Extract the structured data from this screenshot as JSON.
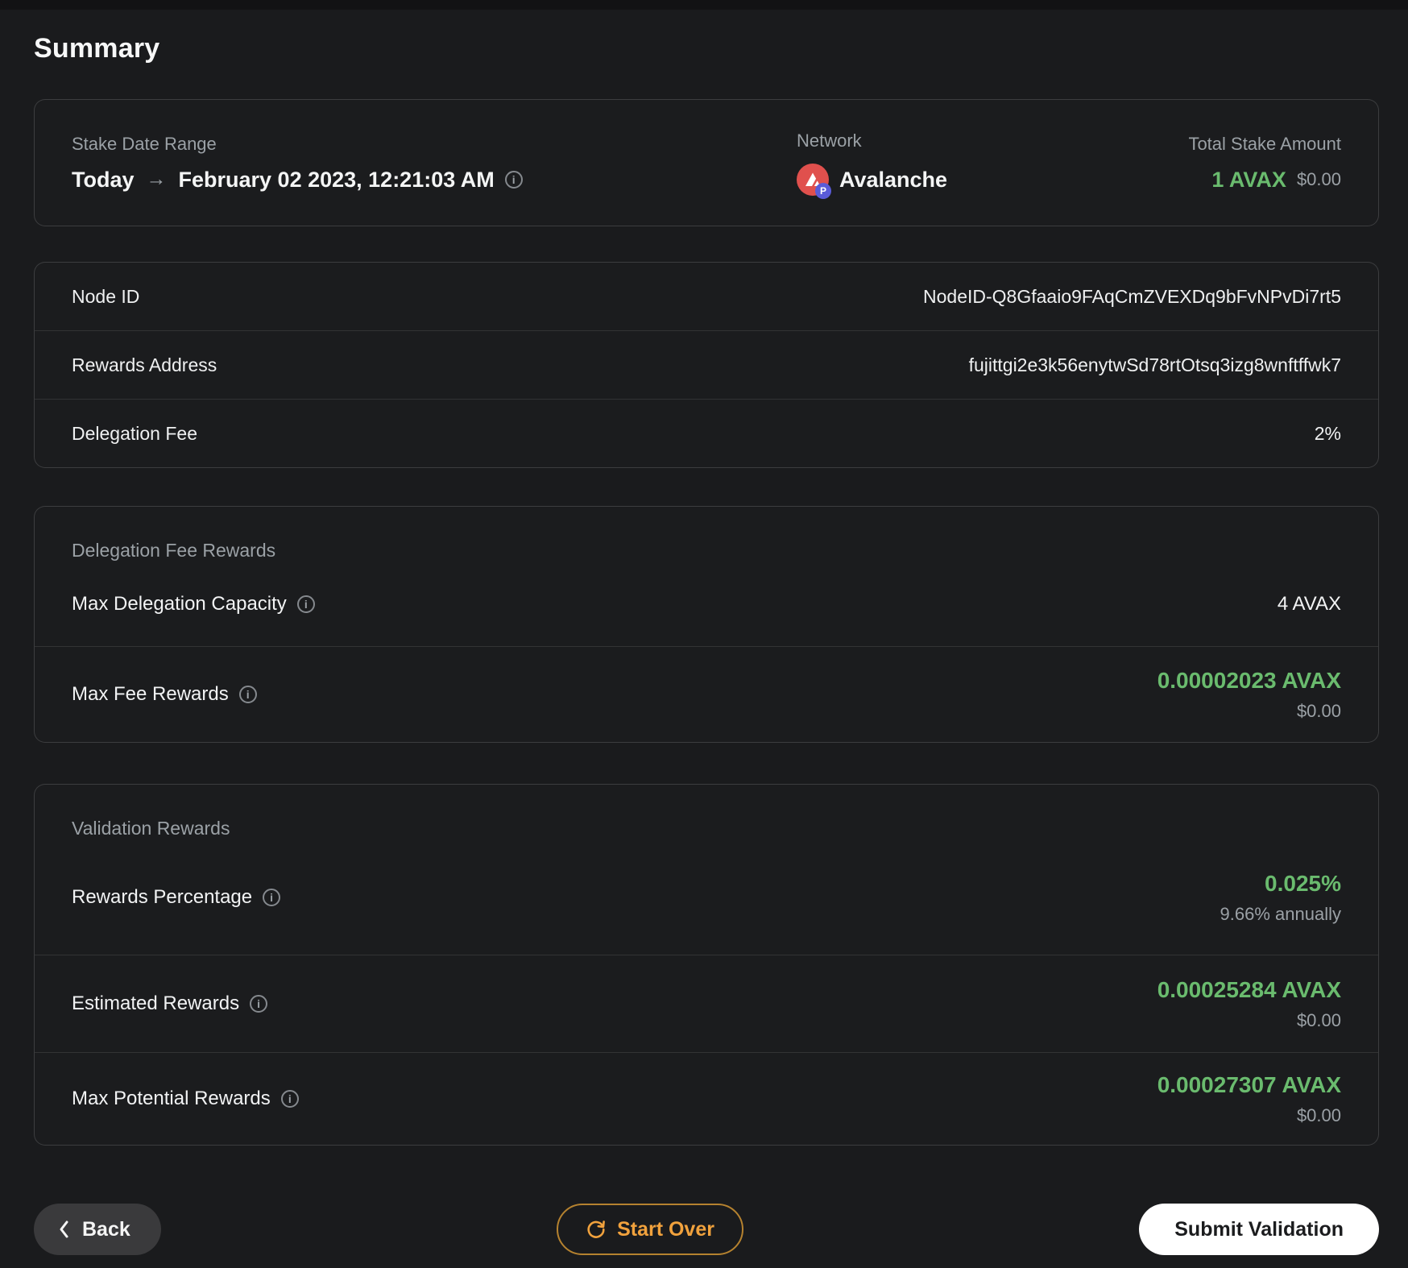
{
  "page": {
    "title": "Summary"
  },
  "colors": {
    "accent_green": "#6abb6e",
    "accent_orange": "#f1a23d",
    "network_red": "#e0504d",
    "p_badge_purple": "#5a5bd8"
  },
  "overview": {
    "stake_date_range": {
      "label": "Stake Date Range",
      "from": "Today",
      "arrow": "→",
      "to": "February 02 2023, 12:21:03 AM"
    },
    "network": {
      "label": "Network",
      "name": "Avalanche",
      "icon": "avalanche-icon",
      "badge": "P"
    },
    "total_stake": {
      "label": "Total Stake Amount",
      "amount": "1 AVAX",
      "fiat": "$0.00"
    }
  },
  "details": {
    "rows": [
      {
        "label": "Node ID",
        "value": "NodeID-Q8Gfaaio9FAqCmZVEXDq9bFvNPvDi7rt5"
      },
      {
        "label": "Rewards Address",
        "value": "fujittgi2e3k56enytwSd78rtOtsq3izg8wnftffwk7"
      },
      {
        "label": "Delegation Fee",
        "value": "2%"
      }
    ]
  },
  "fee_rewards": {
    "title": "Delegation Fee Rewards",
    "capacity": {
      "label": "Max Delegation Capacity",
      "value": "4 AVAX"
    },
    "max_fee": {
      "label": "Max Fee Rewards",
      "value": "0.00002023 AVAX",
      "fiat": "$0.00"
    }
  },
  "validation": {
    "title": "Validation Rewards",
    "rows": [
      {
        "label": "Rewards Percentage",
        "value": "0.025%",
        "sub": "9.66% annually"
      },
      {
        "label": "Estimated Rewards",
        "value": "0.00025284 AVAX",
        "sub": "$0.00"
      },
      {
        "label": "Max Potential Rewards",
        "value": "0.00027307 AVAX",
        "sub": "$0.00"
      }
    ]
  },
  "footer": {
    "back_label": "Back",
    "start_over_label": "Start Over",
    "submit_label": "Submit Validation"
  },
  "info_icon_glyph": "i"
}
